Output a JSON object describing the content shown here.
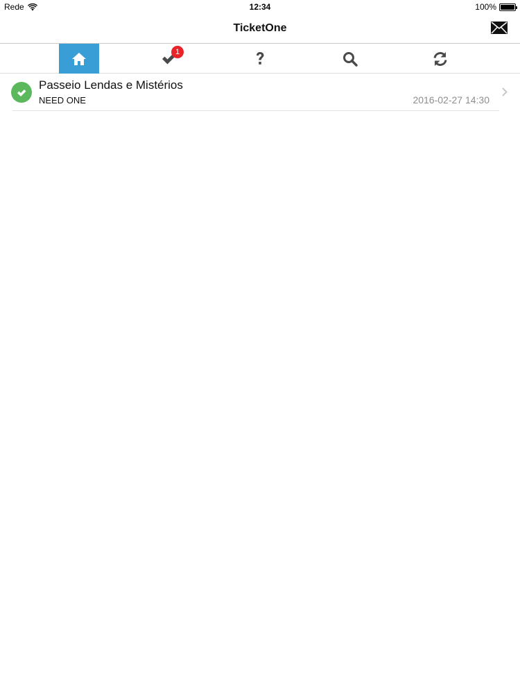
{
  "status_bar": {
    "carrier": "Rede",
    "time": "12:34",
    "battery_percent": "100%",
    "battery_level": 1.0
  },
  "nav": {
    "title": "TicketOne",
    "mail_icon": "envelope-icon"
  },
  "tabs": [
    {
      "icon": "home-icon",
      "active": true
    },
    {
      "icon": "checkmark-icon",
      "active": false,
      "badge": "1"
    },
    {
      "icon": "question-icon",
      "active": false
    },
    {
      "icon": "search-icon",
      "active": false
    },
    {
      "icon": "refresh-icon",
      "active": false
    }
  ],
  "colors": {
    "active_tab": "#3a9ed6",
    "badge": "#e8242a",
    "status_ok": "#5cb85c"
  },
  "tickets": [
    {
      "title": "Passeio Lendas e Mistérios",
      "subtitle": "NEED ONE",
      "date": "2016-02-27 14:30",
      "status_icon": "check-circle-icon"
    }
  ]
}
